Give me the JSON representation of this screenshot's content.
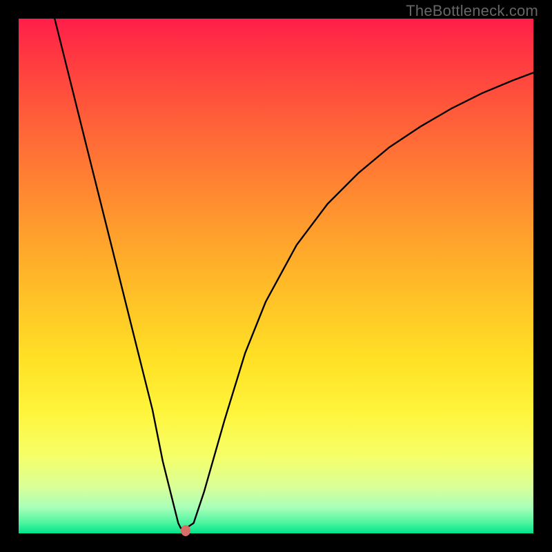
{
  "watermark": "TheBottleneck.com",
  "chart_data": {
    "type": "line",
    "title": "",
    "xlabel": "",
    "ylabel": "",
    "xlim": [
      0,
      100
    ],
    "ylim": [
      0,
      100
    ],
    "grid": false,
    "series": [
      {
        "name": "curve",
        "x": [
          7,
          10,
          14,
          18,
          22,
          26,
          28,
          30,
          31,
          31.5,
          32.5,
          34,
          36,
          40,
          44,
          48,
          54,
          60,
          66,
          72,
          78,
          84,
          90,
          96,
          100
        ],
        "y": [
          100,
          88,
          72,
          56,
          40,
          24,
          14,
          6,
          2,
          1,
          1,
          2,
          8,
          22,
          35,
          45,
          56,
          64,
          70,
          75,
          79,
          82.5,
          85.5,
          88,
          89.5
        ]
      }
    ],
    "marker": {
      "x": 32.5,
      "y": 0.6,
      "color": "#d56f67"
    }
  },
  "colors": {
    "frame": "#000000",
    "gradient_top": "#ff1e4a",
    "gradient_bottom": "#00e58b",
    "curve": "#000000",
    "marker": "#d56f67",
    "watermark": "#666666"
  }
}
